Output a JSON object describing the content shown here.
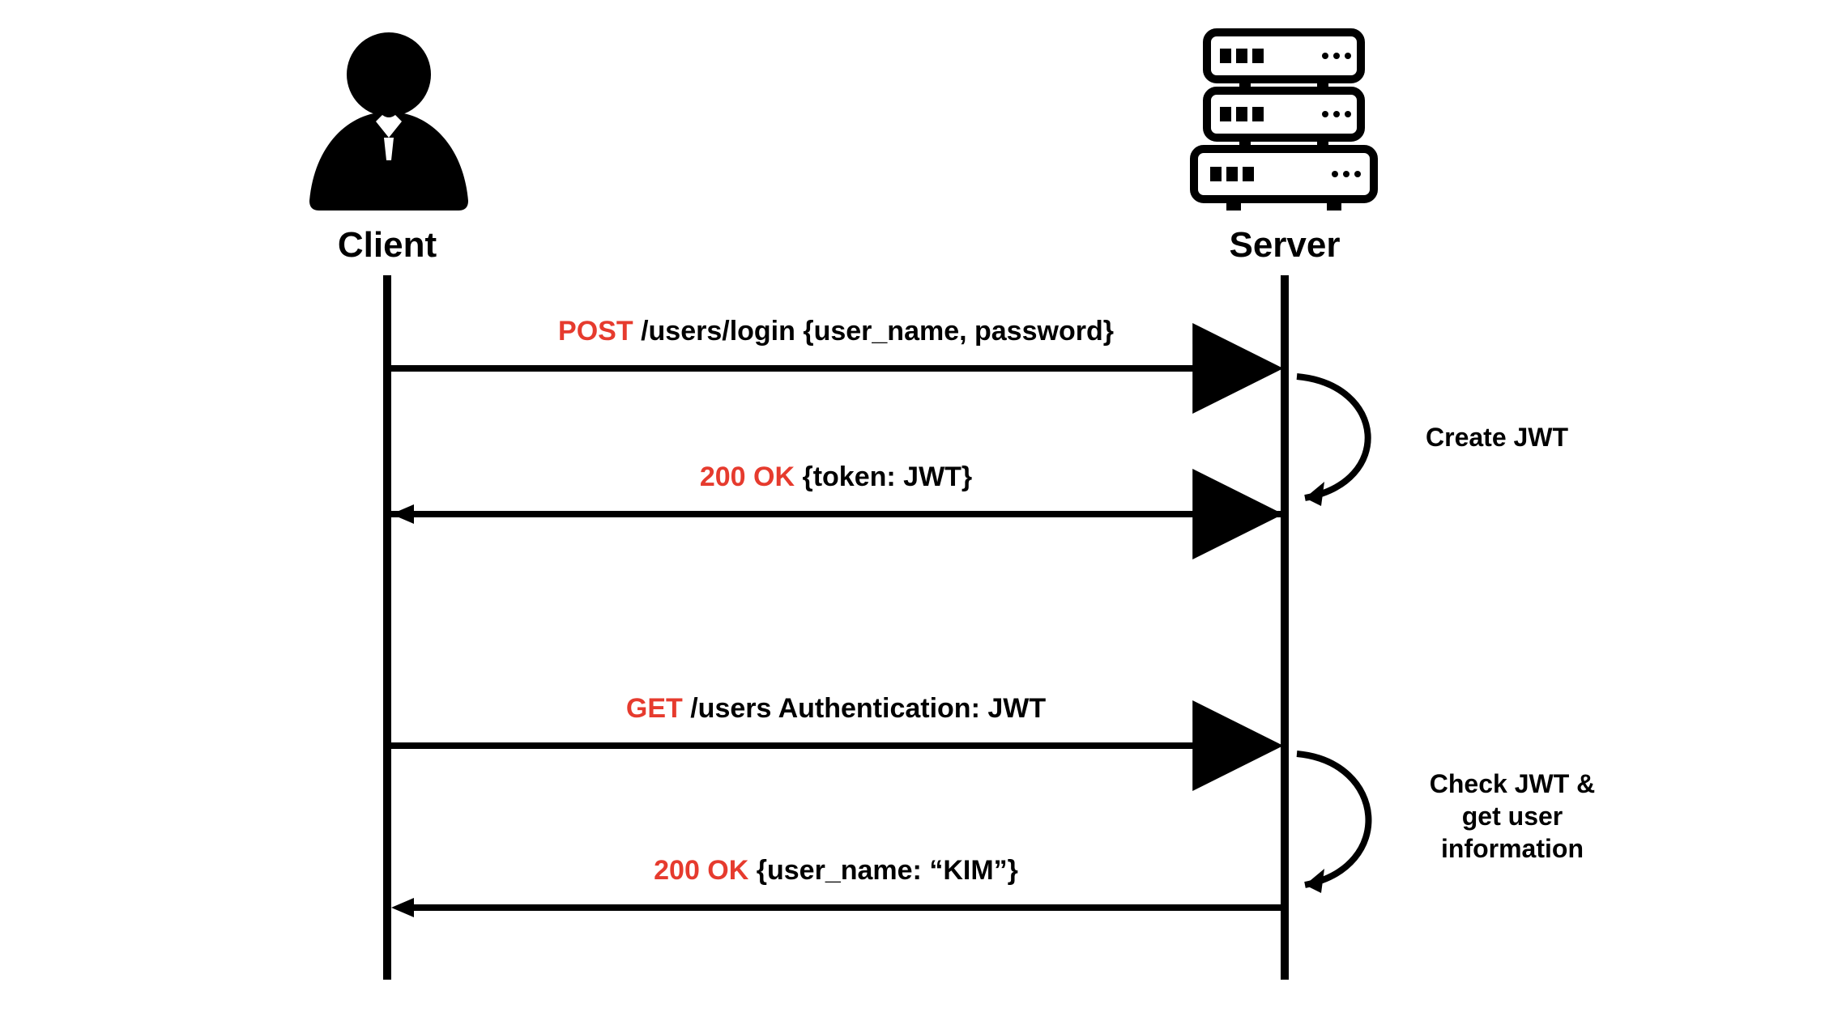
{
  "actors": {
    "client_label": "Client",
    "server_label": "Server"
  },
  "messages": {
    "m1": {
      "method": "POST",
      "rest": " /users/login {user_name, password}"
    },
    "m2": {
      "method": "200 OK",
      "rest": " {token: JWT}"
    },
    "m3": {
      "method": "GET",
      "rest": " /users Authentication: JWT"
    },
    "m4": {
      "method": "200 OK",
      "rest": " {user_name: “KIM”}"
    }
  },
  "notes": {
    "n1": "Create JWT",
    "n2_line1": "Check JWT &",
    "n2_line2": "get user",
    "n2_line3": "information"
  },
  "colors": {
    "highlight": "#e63b2e",
    "ink": "#000000"
  }
}
